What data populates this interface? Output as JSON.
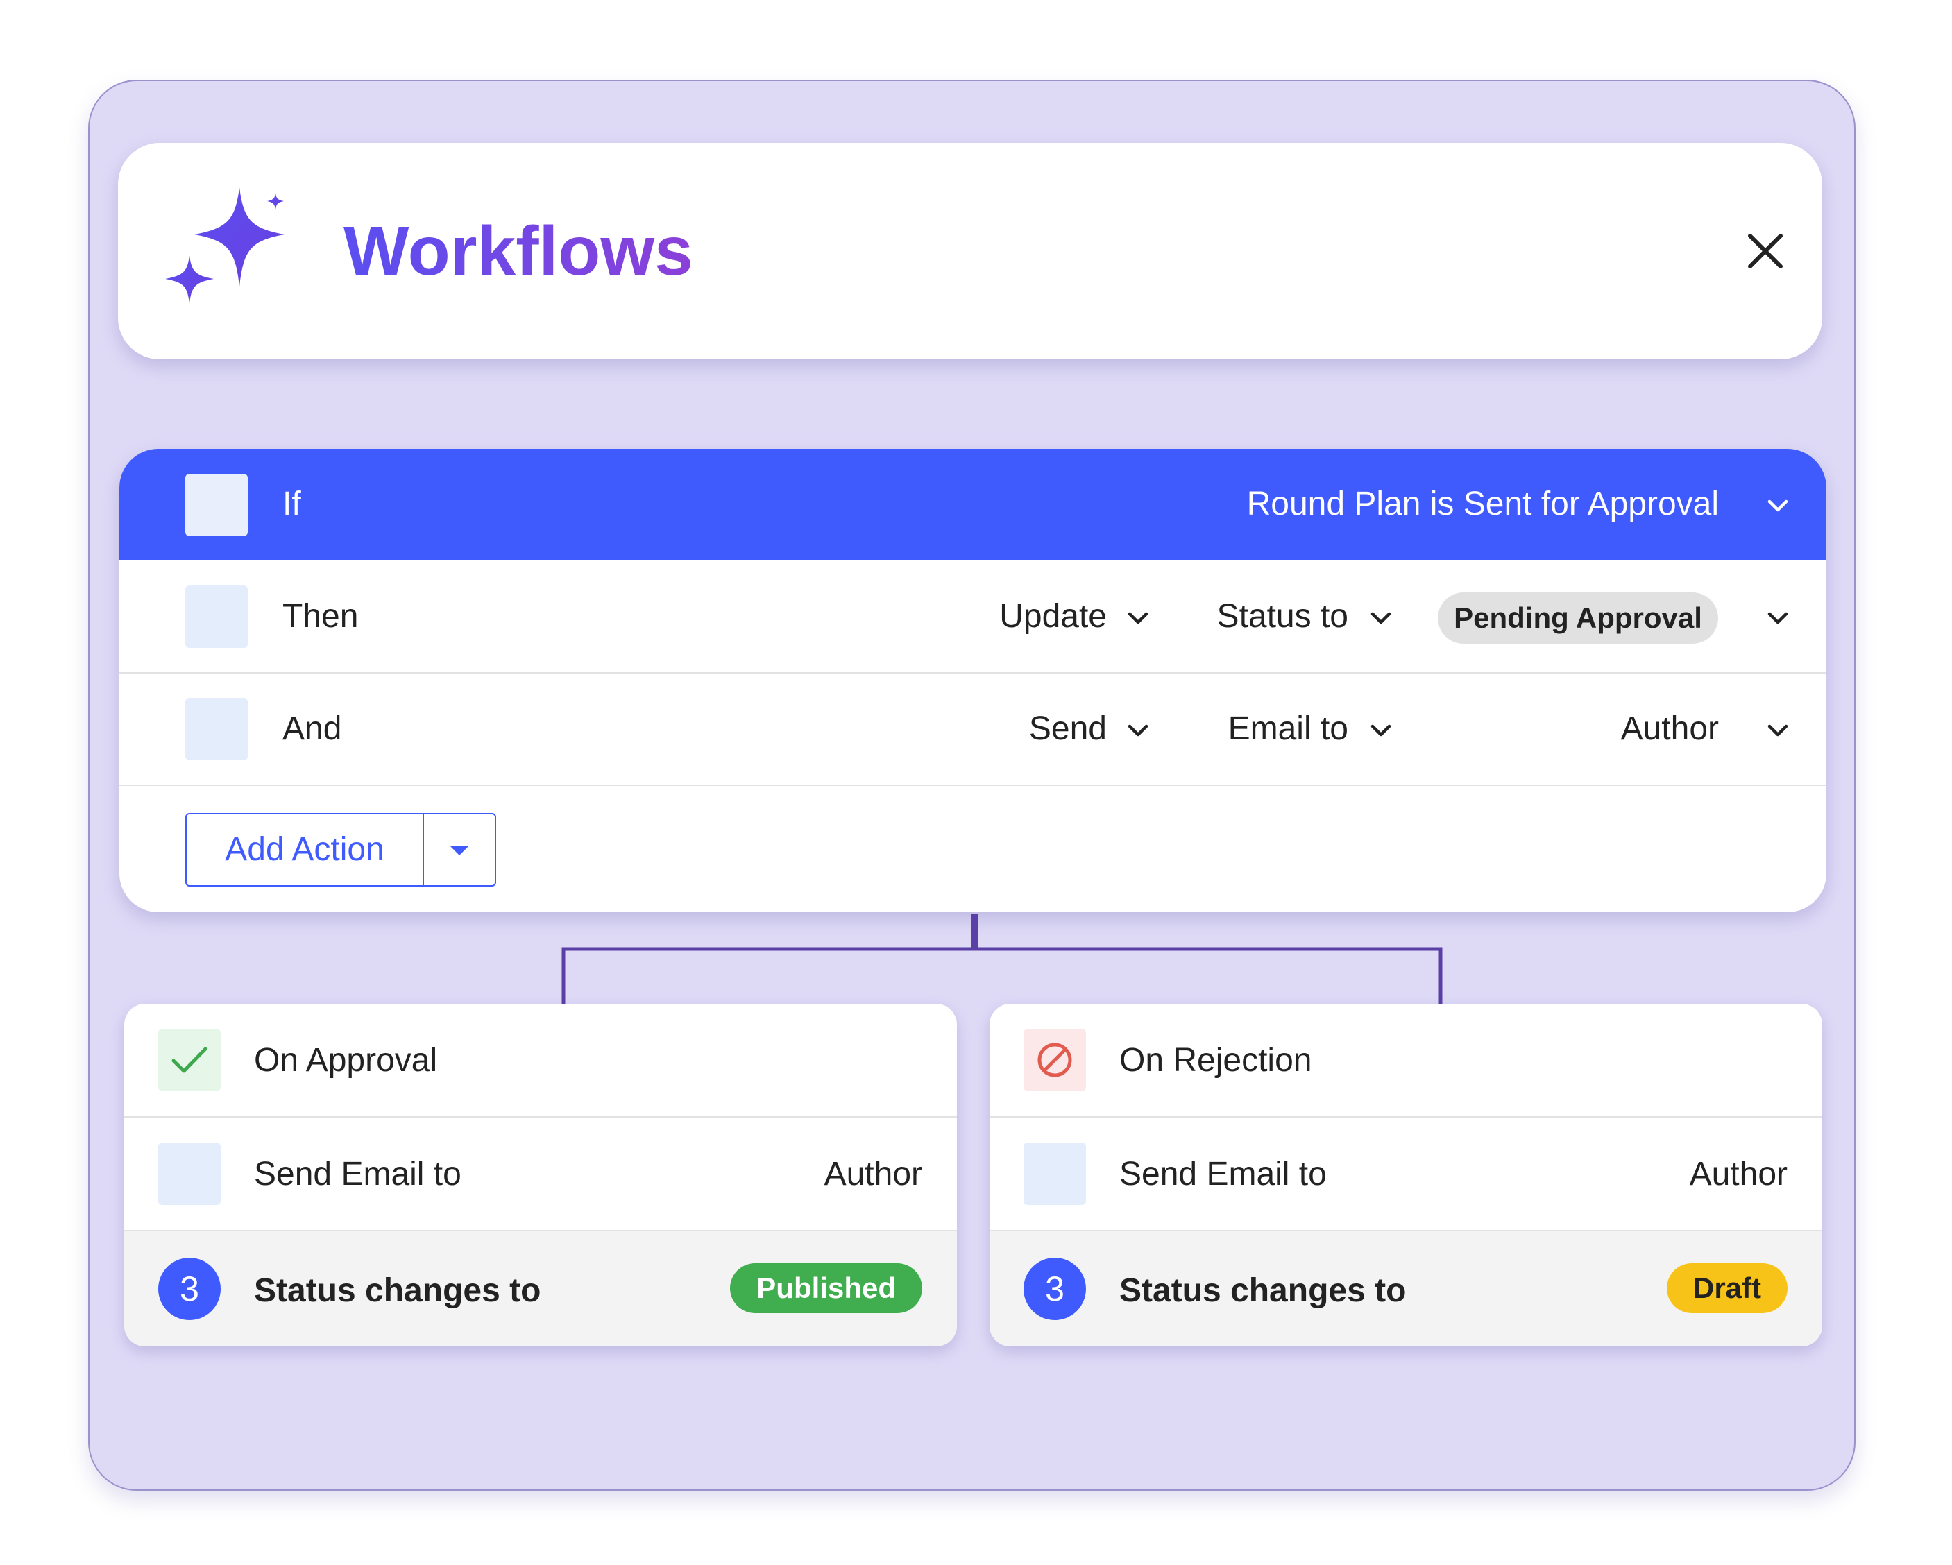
{
  "header": {
    "title": "Workflows",
    "icon": "sparkles-icon",
    "close_icon": "close-icon"
  },
  "rules": {
    "if_row": {
      "label": "If",
      "trigger": "Round Plan is Sent for Approval"
    },
    "then_row": {
      "label": "Then",
      "action": "Update",
      "target": "Status to",
      "value": "Pending Approval"
    },
    "and_row": {
      "label": "And",
      "action": "Send",
      "target": "Email to",
      "value": "Author"
    },
    "add_action": {
      "label": "Add Action"
    }
  },
  "branches": {
    "approval": {
      "title": "On Approval",
      "icon": "check-icon",
      "email_label": "Send Email to",
      "email_value": "Author",
      "step_number": "3",
      "status_label": "Status changes to",
      "status_value": "Published",
      "status_color": "#40ad4f"
    },
    "rejection": {
      "title": "On Rejection",
      "icon": "block-icon",
      "email_label": "Send Email to",
      "email_value": "Author",
      "step_number": "3",
      "status_label": "Status changes to",
      "status_value": "Draft",
      "status_color": "#f8c319"
    }
  },
  "colors": {
    "accent": "#3f5bfd",
    "connector": "#5a3fa6",
    "background": "#dedaf6"
  }
}
